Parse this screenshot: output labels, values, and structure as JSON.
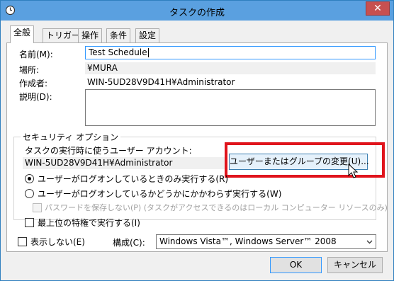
{
  "window": {
    "title": "タスクの作成",
    "close_glyph": "✕"
  },
  "tabs": [
    {
      "label": "全般"
    },
    {
      "label": "トリガー"
    },
    {
      "label": "操作"
    },
    {
      "label": "条件"
    },
    {
      "label": "設定"
    }
  ],
  "general": {
    "name_label": "名前(M):",
    "name_value": "Test Schedule",
    "location_label": "場所:",
    "location_value": "¥MURA",
    "author_label": "作成者:",
    "author_value": "WIN-5UD28V9D41H¥Administrator",
    "description_label": "説明(D):",
    "description_value": ""
  },
  "security": {
    "legend": "セキュリティ オプション",
    "account_label": "タスクの実行時に使うユーザー アカウント:",
    "account_value": "WIN-5UD28V9D41H¥Administrator",
    "change_button": "ユーザーまたはグループの変更(U)...",
    "radio_logged_on": "ユーザーがログオンしているときのみ実行する(R)",
    "radio_whether": "ユーザーがログオンしているかどうかにかかわらず実行する(W)",
    "no_store_password": "パスワードを保存しない(P) (タスクがアクセスできるのはローカル コンピューター リソースのみ)",
    "highest_privileges": "最上位の特権で実行する(I)"
  },
  "bottom": {
    "hidden_label": "表示しない(E)",
    "configure_label": "構成(C):",
    "configure_value": "Windows Vista™, Windows Server™ 2008"
  },
  "buttons": {
    "ok": "OK",
    "cancel": "キャンセル"
  },
  "colors": {
    "highlight": "#e0141c",
    "titlebar": "#5aa0e0",
    "close": "#c75050"
  }
}
